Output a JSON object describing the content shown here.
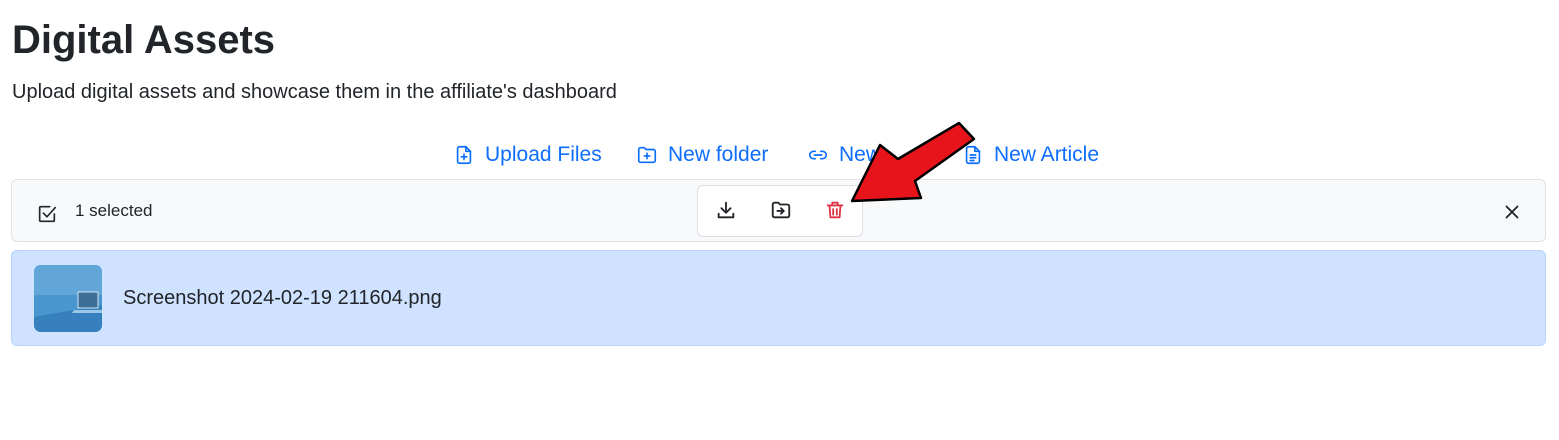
{
  "page": {
    "title": "Digital Assets",
    "subtitle": "Upload digital assets and showcase them in the affiliate's dashboard"
  },
  "actions": {
    "upload_files": {
      "label": "Upload Files",
      "icon": "file-plus-icon"
    },
    "new_folder": {
      "label": "New folder",
      "icon": "folder-plus-icon"
    },
    "new_link": {
      "label": "New",
      "icon": "link-icon"
    },
    "new_article": {
      "label": "New Article",
      "icon": "file-text-icon"
    }
  },
  "selection_bar": {
    "count_label": "1 selected",
    "icons": [
      "checkbox-icon",
      "download-icon",
      "move-to-folder-icon",
      "trash-icon",
      "close-icon"
    ]
  },
  "files": [
    {
      "name": "Screenshot 2024-02-19 211604.png",
      "selected": true
    }
  ],
  "colors": {
    "accent": "#0d6efd",
    "danger": "#dc3545",
    "selected_row": "#cfe2ff",
    "annotation_arrow": "#e8141b"
  }
}
